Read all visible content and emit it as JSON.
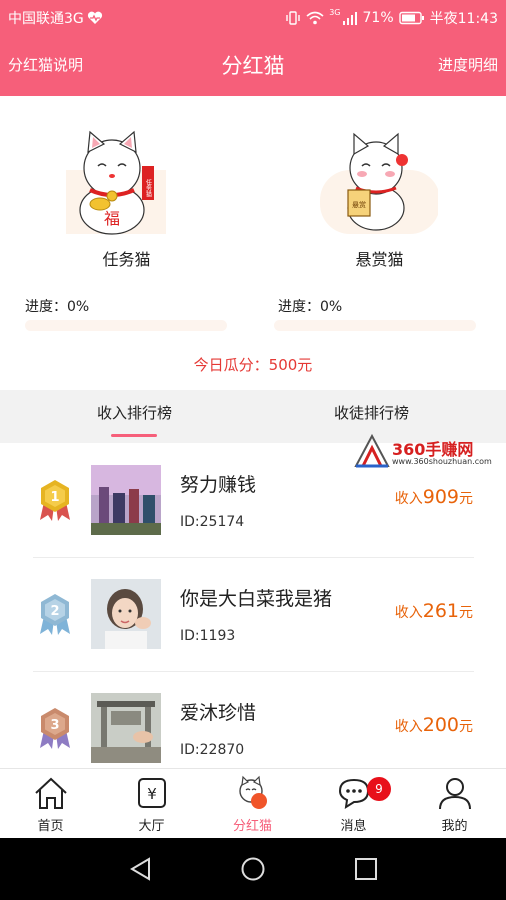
{
  "status_bar": {
    "carrier": "中国联通3G",
    "network": "3G",
    "battery": "71%",
    "time": "半夜11:43"
  },
  "header": {
    "left_link": "分红猫说明",
    "title": "分红猫",
    "right_link": "进度明细"
  },
  "cats": [
    {
      "name": "任务猫",
      "progress_label": "进度：",
      "progress_value": "0%",
      "progress_fraction": 0,
      "tag": "任务猫",
      "belly": "福"
    },
    {
      "name": "悬赏猫",
      "progress_label": "进度：",
      "progress_value": "0%",
      "progress_fraction": 0,
      "tag": "悬赏"
    }
  ],
  "today_dividend": "今日瓜分：500元",
  "tabs": [
    {
      "label": "收入排行榜",
      "active": true
    },
    {
      "label": "收徒排行榜",
      "active": false
    }
  ],
  "watermark": {
    "title": "360手赚网",
    "url": "www.360shouzhuan.com"
  },
  "ranking": [
    {
      "rank": "1",
      "name": "努力赚钱",
      "id": "ID:25174",
      "income_prefix": "收入",
      "income_value": "909",
      "income_unit": "元",
      "medal_color": "#e6b422"
    },
    {
      "rank": "2",
      "name": "你是大白菜我是猪",
      "id": "ID:1193",
      "income_prefix": "收入",
      "income_value": "261",
      "income_unit": "元",
      "medal_color": "#8fb8d4"
    },
    {
      "rank": "3",
      "name": "爱沐珍惜",
      "id": "ID:22870",
      "income_prefix": "收入",
      "income_value": "200",
      "income_unit": "元",
      "medal_color": "#c98a6c"
    }
  ],
  "bottom_nav": [
    {
      "label": "首页",
      "icon": "home-icon"
    },
    {
      "label": "大厅",
      "icon": "yuan-icon"
    },
    {
      "label": "分红猫",
      "icon": "cat-icon",
      "active": true
    },
    {
      "label": "消息",
      "icon": "message-icon",
      "badge": "9"
    },
    {
      "label": "我的",
      "icon": "user-icon"
    }
  ],
  "colors": {
    "brand": "#f65f7a",
    "income": "#e8630a",
    "today": "#e53935",
    "badge": "#e8101a"
  }
}
